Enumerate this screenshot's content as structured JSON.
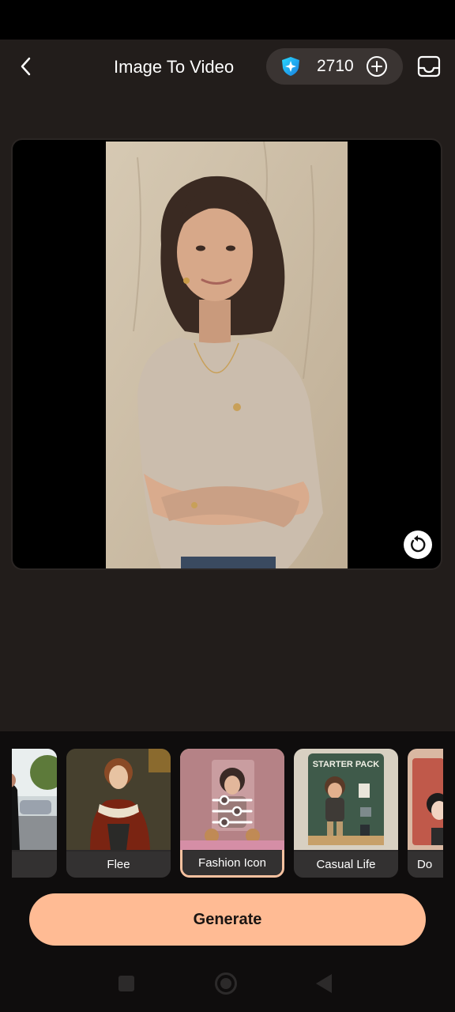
{
  "header": {
    "title": "Image To Video",
    "credits": "2710"
  },
  "templates": [
    {
      "label": "n"
    },
    {
      "label": "Flee"
    },
    {
      "label": "Fashion Icon",
      "selected": true
    },
    {
      "label": "Casual Life",
      "poster_text": "STARTER PACK"
    },
    {
      "label": "Do"
    }
  ],
  "actions": {
    "generate": "Generate"
  },
  "colors": {
    "background": "#221d1b",
    "accent": "#ffbb94",
    "selected_outline": "#f8c2a0",
    "credits_gem": "#2ec4f1"
  }
}
